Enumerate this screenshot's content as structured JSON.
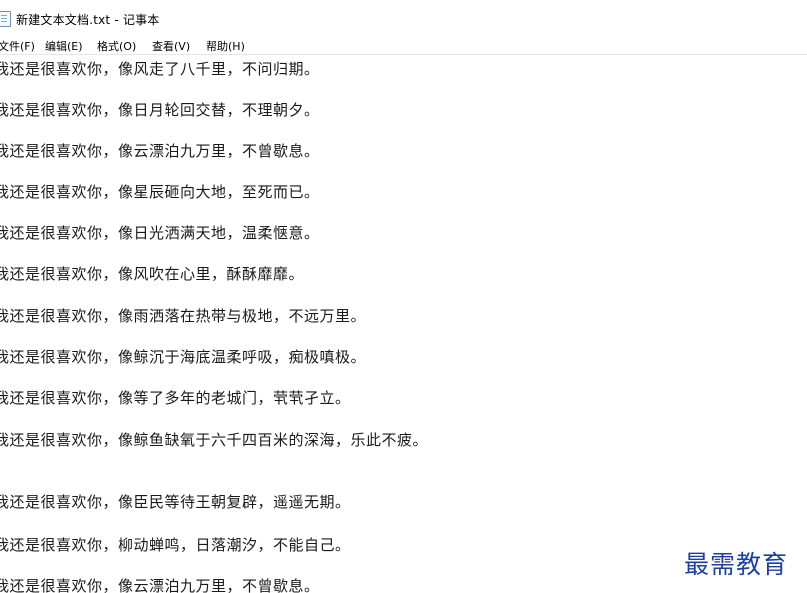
{
  "window": {
    "title": "新建文本文档.txt - 记事本"
  },
  "menu": {
    "items": [
      "文件(F)",
      "编辑(E)",
      "格式(O)",
      "查看(V)",
      "帮助(H)"
    ]
  },
  "content": {
    "lines": [
      "我还是很喜欢你，像风走了八千里，不问归期。",
      "我还是很喜欢你，像日月轮回交替，不理朝夕。",
      "我还是很喜欢你，像云漂泊九万里，不曾歇息。",
      "我还是很喜欢你，像星辰砸向大地，至死而已。",
      "我还是很喜欢你，像日光洒满天地，温柔惬意。",
      "我还是很喜欢你，像风吹在心里，酥酥靡靡。",
      "我还是很喜欢你，像雨洒落在热带与极地，不远万里。",
      "我还是很喜欢你，像鲸沉于海底温柔呼吸，痴极嗔极。",
      "我还是很喜欢你，像等了多年的老城门，茕茕孑立。",
      "我还是很喜欢你，像鲸鱼缺氧于六千四百米的深海，乐此不疲。",
      "我还是很喜欢你，像臣民等待王朝复辟，遥遥无期。",
      "我还是很喜欢你，柳动蝉鸣，日落潮汐，不能自己。",
      "我还是很喜欢你，像云漂泊九万里，不曾歇息。"
    ]
  },
  "watermark": {
    "text": "最需教育"
  }
}
